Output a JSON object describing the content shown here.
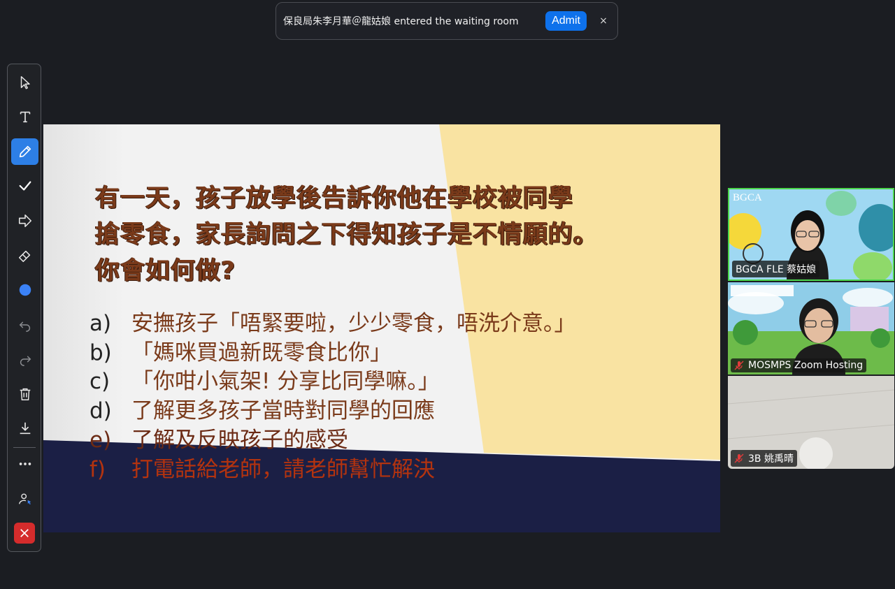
{
  "notification": {
    "message": "保良局朱李月華＠龍姑娘 entered the waiting room",
    "admit_label": "Admit",
    "close_label": "×"
  },
  "toolbar": {
    "tools": [
      "select",
      "text",
      "draw",
      "stamp",
      "spotlight",
      "eraser",
      "format",
      "undo",
      "redo",
      "clear",
      "save",
      "more",
      "request-control",
      "close-annotation"
    ],
    "active": "draw",
    "accent_color": "#2d7fe6",
    "pen_color": "#3b82f6",
    "exit_color": "#d52c2c"
  },
  "slide": {
    "question": "有一天，孩子放學後告訴你他在學校被同學\n搶零食，家長詢問之下得知孩子是不情願的。\n你會如何做?",
    "options": [
      {
        "label": "a)",
        "text": "安撫孩子「唔緊要啦，少少零食，唔洗介意。」"
      },
      {
        "label": "b)",
        "text": "「媽咪買過新既零食比你」"
      },
      {
        "label": "c)",
        "text": "「你咁小氣架! 分享比同學嘛。」"
      },
      {
        "label": "d)",
        "text": "了解更多孩子當時對同學的回應"
      },
      {
        "label": "e)",
        "text": "了解及反映孩子的感受"
      },
      {
        "label": "f)",
        "text": "打電話給老師，請老師幫忙解決"
      }
    ],
    "colors": {
      "panel": "#f9e3a2",
      "navy": "#1b1f45",
      "text": "#7a3a1a"
    }
  },
  "participants": [
    {
      "name": "BGCA FLE 蔡姑娘",
      "logo": "BGCA",
      "muted": false,
      "active_speaker": true
    },
    {
      "name": "MOSMPS Zoom Hosting",
      "logo": "",
      "muted": true,
      "active_speaker": false
    },
    {
      "name": "3B 姚禹晴",
      "logo": "",
      "muted": true,
      "active_speaker": false
    }
  ]
}
